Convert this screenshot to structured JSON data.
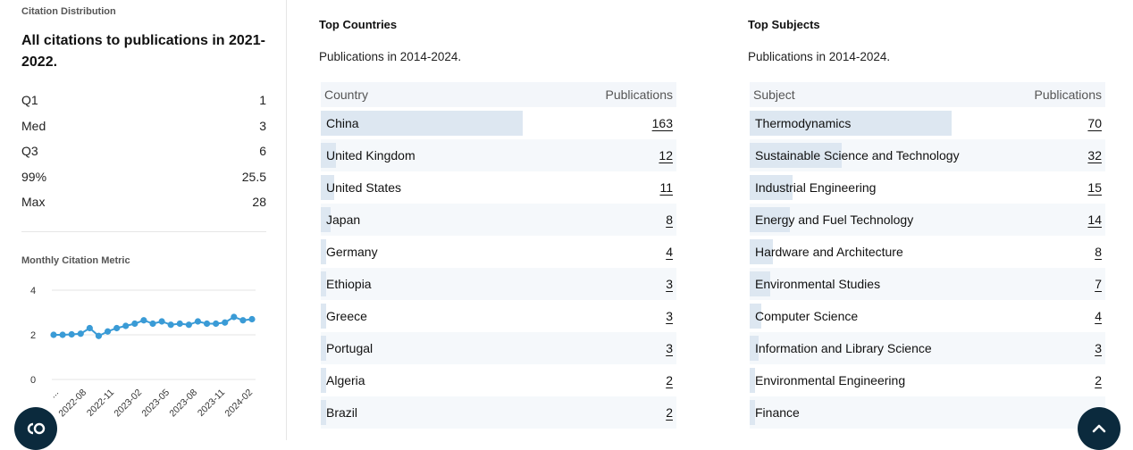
{
  "left": {
    "section_title": "Citation Distribution",
    "heading": "All citations to publications in 2021-2022.",
    "stats": [
      {
        "label": "Q1",
        "value": "1"
      },
      {
        "label": "Med",
        "value": "3"
      },
      {
        "label": "Q3",
        "value": "6"
      },
      {
        "label": "99%",
        "value": "25.5"
      },
      {
        "label": "Max",
        "value": "28"
      }
    ],
    "chart_title": "Monthly Citation Metric"
  },
  "chart_data": {
    "type": "line",
    "title": "Monthly Citation Metric",
    "y_ticks": [
      "4",
      "2",
      "0"
    ],
    "ylim": [
      0,
      4
    ],
    "x_tick_labels": [
      "...",
      "2022-08",
      "2022-11",
      "2023-02",
      "2023-05",
      "2023-08",
      "2023-11",
      "2024-02"
    ],
    "series": [
      {
        "values": [
          2.0,
          2.0,
          2.02,
          2.05,
          2.3,
          1.95,
          2.15,
          2.3,
          2.4,
          2.5,
          2.65,
          2.5,
          2.6,
          2.45,
          2.5,
          2.45,
          2.6,
          2.5,
          2.5,
          2.55,
          2.8,
          2.65,
          2.7
        ]
      }
    ],
    "color": "#3a9bd6"
  },
  "countries": {
    "title": "Top Countries",
    "subtitle": "Publications in 2014-2024.",
    "col_name": "Country",
    "col_value": "Publications",
    "rows": [
      {
        "name": "China",
        "value": "163"
      },
      {
        "name": "United Kingdom",
        "value": "12"
      },
      {
        "name": "United States",
        "value": "11"
      },
      {
        "name": "Japan",
        "value": "8"
      },
      {
        "name": "Germany",
        "value": "4"
      },
      {
        "name": "Ethiopia",
        "value": "3"
      },
      {
        "name": "Greece",
        "value": "3"
      },
      {
        "name": "Portugal",
        "value": "3"
      },
      {
        "name": "Algeria",
        "value": "2"
      },
      {
        "name": "Brazil",
        "value": "2"
      }
    ]
  },
  "subjects": {
    "title": "Top Subjects",
    "subtitle": "Publications in 2014-2024.",
    "col_name": "Subject",
    "col_value": "Publications",
    "rows": [
      {
        "name": "Thermodynamics",
        "value": "70"
      },
      {
        "name": "Sustainable Science and Technology",
        "value": "32"
      },
      {
        "name": "Industrial Engineering",
        "value": "15"
      },
      {
        "name": "Energy and Fuel Technology",
        "value": "14"
      },
      {
        "name": "Hardware and Architecture",
        "value": "8"
      },
      {
        "name": "Environmental Studies",
        "value": "7"
      },
      {
        "name": "Computer Science",
        "value": "4"
      },
      {
        "name": "Information and Library Science",
        "value": "3"
      },
      {
        "name": "Environmental Engineering",
        "value": "2"
      },
      {
        "name": "Finance",
        "value": ""
      }
    ]
  },
  "icons": {
    "footer_button": "cc-icon",
    "top_button": "chevron-up-icon"
  },
  "colors": {
    "bar": "#dde7f1",
    "button": "#0b2a3d",
    "series": "#3a9bd6"
  }
}
